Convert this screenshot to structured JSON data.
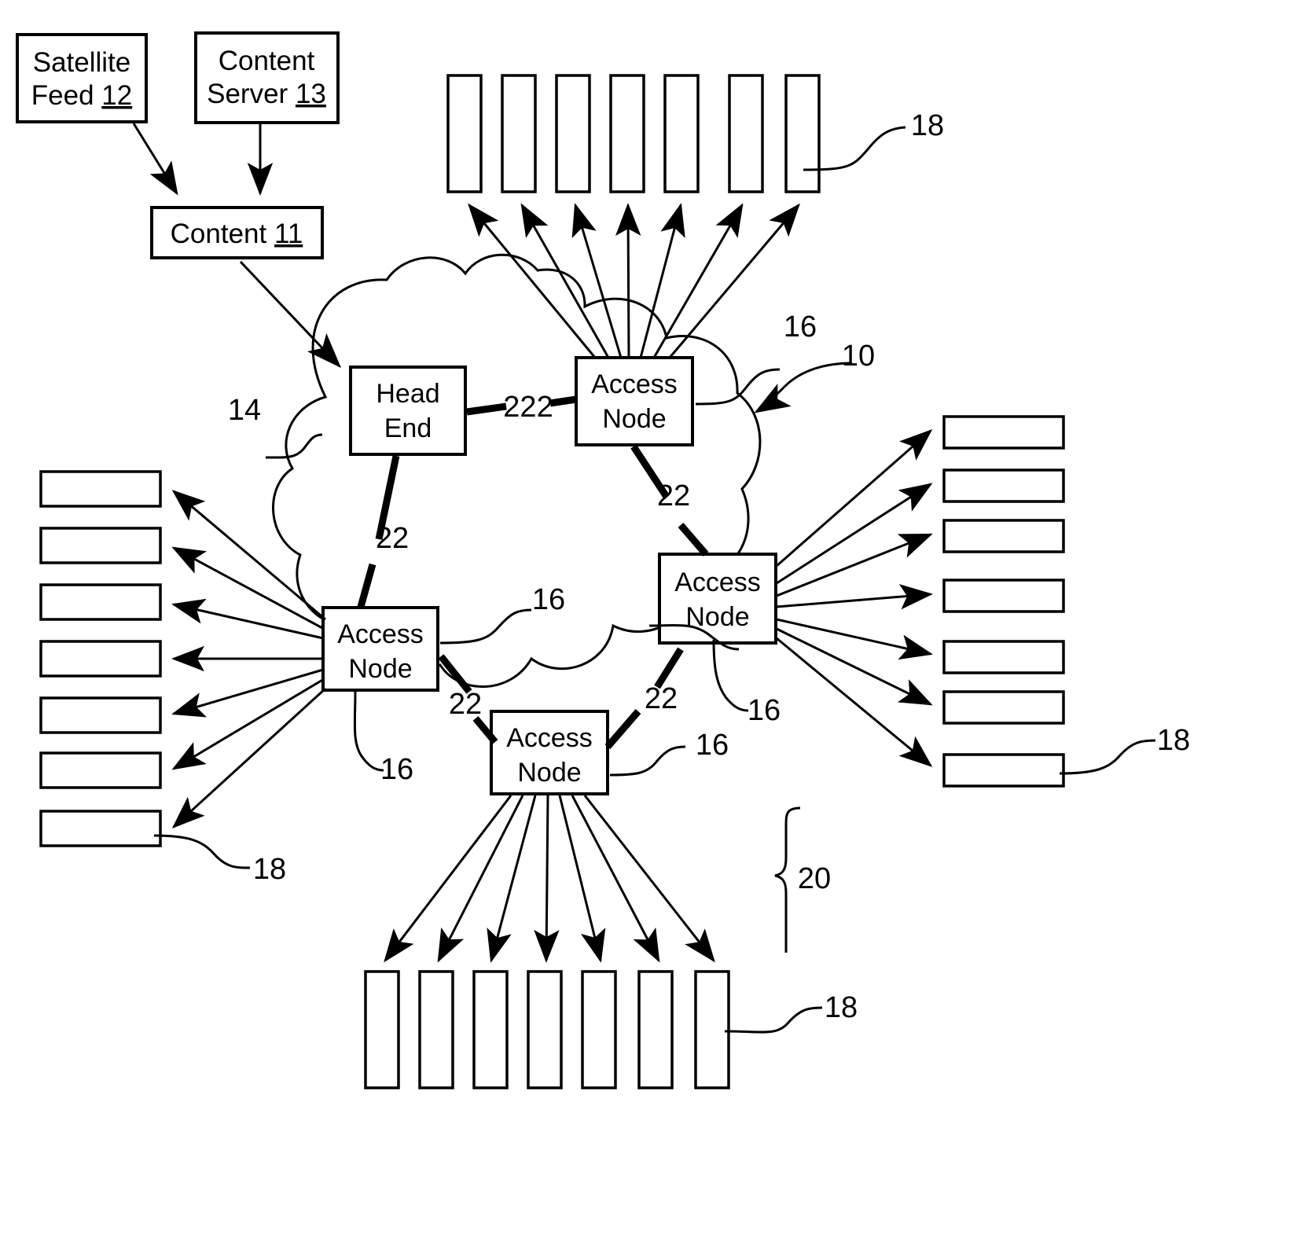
{
  "figure": {
    "kind": "patent-network-diagram",
    "background": "#ffffff",
    "ink": "#000000"
  },
  "sources": {
    "satellite_feed": {
      "line1": "Satellite",
      "line2": "Feed",
      "ref": "12"
    },
    "content_server": {
      "line1": "Content",
      "line2": "Server",
      "ref": "13"
    },
    "content": {
      "line1": "Content",
      "ref": "11"
    }
  },
  "nodes": {
    "head_end": {
      "line1": "Head",
      "line2": "End"
    },
    "access_node_top": {
      "line1": "Access",
      "line2": "Node"
    },
    "access_node_left": {
      "line1": "Access",
      "line2": "Node"
    },
    "access_node_right": {
      "line1": "Access",
      "line2": "Node"
    },
    "access_node_bottom": {
      "line1": "Access",
      "line2": "Node"
    }
  },
  "reference_numerals": {
    "system": "10",
    "content": "11",
    "satellite_feed": "12",
    "content_server": "13",
    "head_end": "14",
    "access_node": "16",
    "subscriber": "18",
    "subscriber_group": "20",
    "link": "22",
    "link_head_end_to_access": "222"
  },
  "labels": {
    "ref_10": "10",
    "ref_14": "14",
    "ref_16_top": "16",
    "ref_16_left": "16",
    "ref_16_left_lower": "16",
    "ref_16_right": "16",
    "ref_16_right_lower": "16",
    "ref_16_bottom": "16",
    "ref_18_top": "18",
    "ref_18_left": "18",
    "ref_18_right": "18",
    "ref_18_bottom": "18",
    "ref_20": "20",
    "ref_22_headend": "22",
    "ref_22_top_right": "22",
    "ref_22_left": "22",
    "ref_22_bottom_right": "22",
    "ref_222": "222"
  },
  "subscriber_groups": {
    "top": {
      "count": 7,
      "orientation": "vertical",
      "ref": "18"
    },
    "left": {
      "count": 7,
      "orientation": "horizontal",
      "ref": "18"
    },
    "right": {
      "count": 7,
      "orientation": "horizontal",
      "ref": "18"
    },
    "bottom": {
      "count": 7,
      "orientation": "vertical",
      "ref": "18"
    }
  }
}
